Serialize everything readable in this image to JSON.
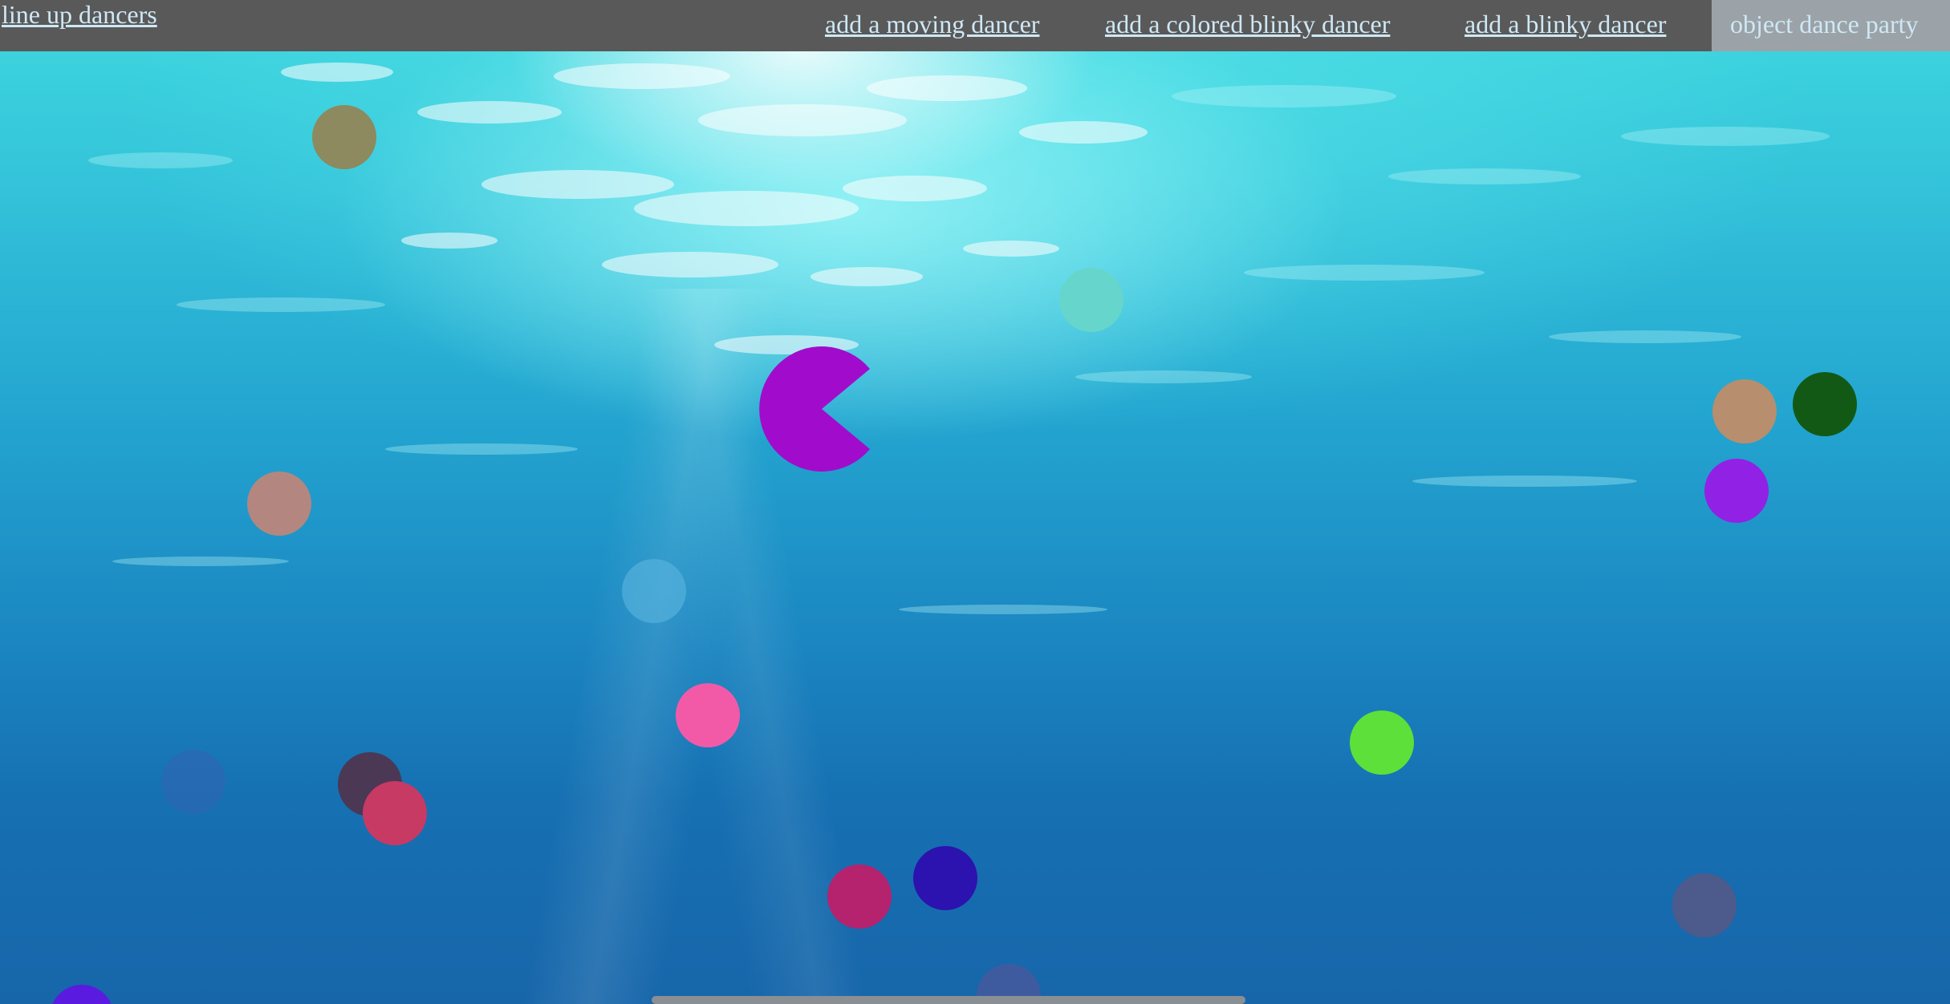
{
  "nav": {
    "line_up": "line up dancers",
    "add_moving": "add a moving dancer",
    "add_colored_blinky": "add a colored blinky dancer",
    "add_blinky": "add a blinky dancer",
    "party": "object dance party"
  },
  "colors": {
    "topbar": "#595959",
    "link": "#cfe8f5",
    "party_bg": "#9ba3a8",
    "pacman": "#a10ccc"
  },
  "dancers": [
    {
      "color": "#8c8a5e"
    },
    {
      "color": "#66d6cc"
    },
    {
      "color": "#b3877f"
    },
    {
      "color": "#5bb5e0"
    },
    {
      "color": "#f25aa8"
    },
    {
      "color": "#2e66b3"
    },
    {
      "color": "#4a3855"
    },
    {
      "color": "#c63a64"
    },
    {
      "color": "#b5226e"
    },
    {
      "color": "#2c12ae"
    },
    {
      "color": "#3f5ba0"
    },
    {
      "color": "#5ee03a"
    },
    {
      "color": "#135916"
    },
    {
      "color": "#b78e6e"
    },
    {
      "color": "#9221e6"
    },
    {
      "color": "#4c5a8c"
    },
    {
      "color": "#5b1ae0"
    }
  ]
}
